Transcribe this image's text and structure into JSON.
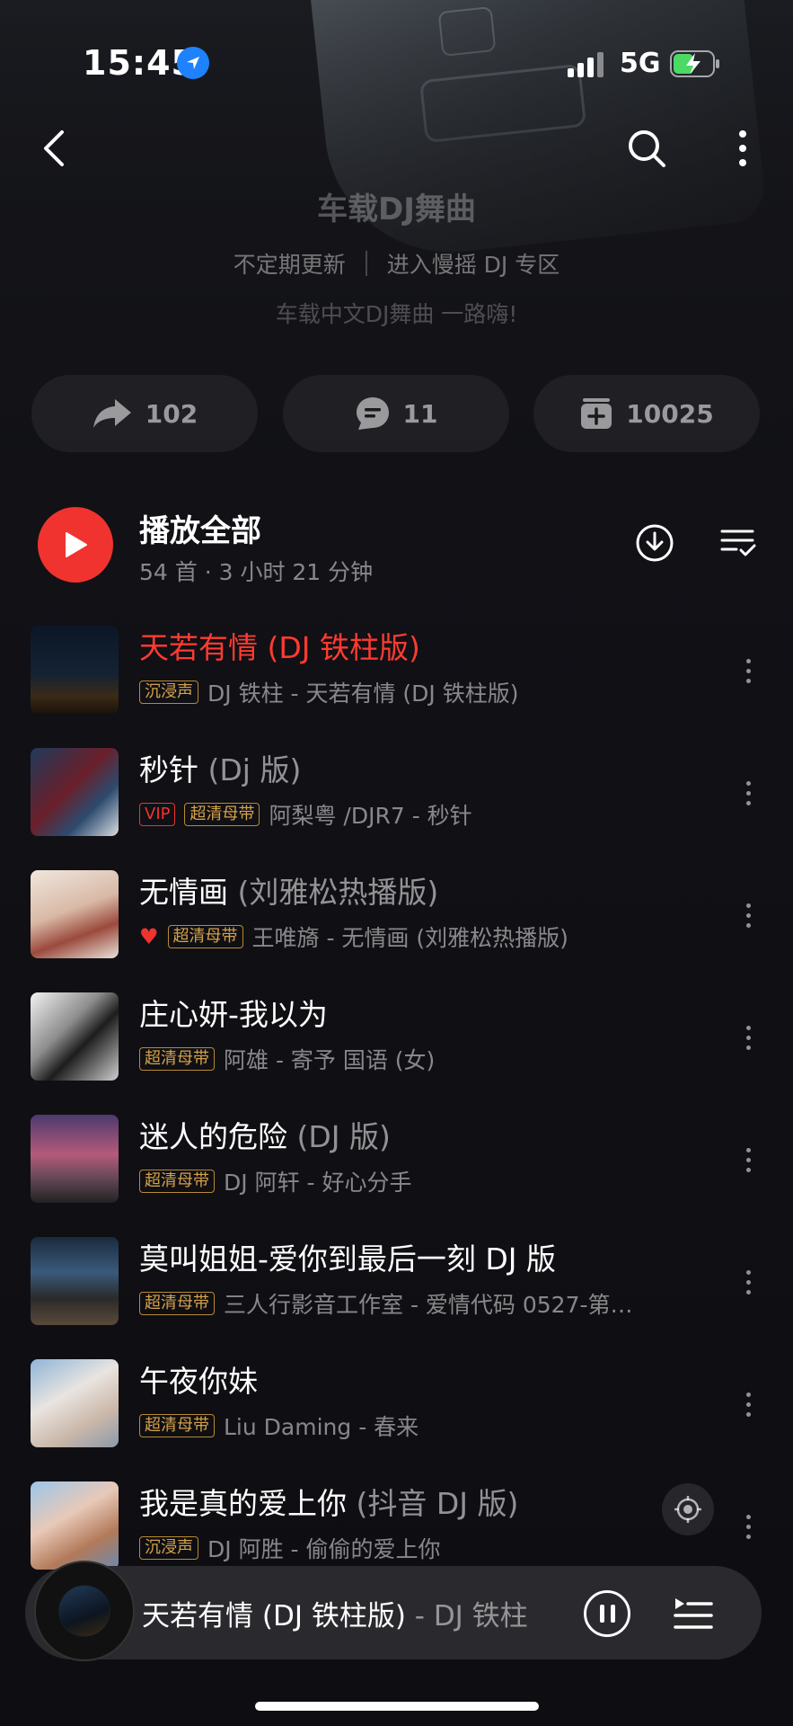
{
  "status": {
    "time": "15:45",
    "network": "5G"
  },
  "header": {
    "title": "车载DJ舞曲",
    "update_label": "不定期更新",
    "zone_link": "进入慢摇 DJ 专区",
    "description": "车载中文DJ舞曲 一路嗨!"
  },
  "actions": {
    "share_count": "102",
    "comment_count": "11",
    "collect_count": "10025"
  },
  "play_all": {
    "label": "播放全部",
    "meta": "54 首 · 3 小时 21 分钟"
  },
  "songs": [
    {
      "title": "天若有情 ",
      "version": "(DJ 铁柱版)",
      "tags": [
        "沉浸声"
      ],
      "subtitle": "DJ 铁柱 - 天若有情 (DJ 铁柱版)"
    },
    {
      "title": "秒针 ",
      "version": "(Dj 版)",
      "tags": [
        "VIP",
        "超清母带"
      ],
      "subtitle": "阿梨粤 /DJR7 - 秒针"
    },
    {
      "title": "无情画 ",
      "version": "(刘雅松热播版)",
      "tags": [
        "超清母带"
      ],
      "subtitle": "王唯旖 - 无情画 (刘雅松热播版)"
    },
    {
      "title": "庄心妍-我以为",
      "version": "",
      "tags": [
        "超清母带"
      ],
      "subtitle": "阿雄 - 寄予 国语 (女)"
    },
    {
      "title": "迷人的危险 ",
      "version": "(DJ 版)",
      "tags": [
        "超清母带"
      ],
      "subtitle": "DJ 阿轩 - 好心分手"
    },
    {
      "title": "莫叫姐姐-爱你到最后一刻 DJ 版",
      "version": "",
      "tags": [
        "超清母带"
      ],
      "subtitle": "三人行影音工作室 - 爱情代码 0527-第…"
    },
    {
      "title": "午夜你妹",
      "version": "",
      "tags": [
        "超清母带"
      ],
      "subtitle": "Liu Daming - 春来"
    },
    {
      "title": "我是真的爱上你 ",
      "version": "(抖音 DJ 版)",
      "tags": [
        "沉浸声"
      ],
      "subtitle": "DJ 阿胜 - 偷偷的爱上你"
    }
  ],
  "mini_player": {
    "title": "天若有情 (DJ 铁柱版)",
    "artist": " - DJ 铁柱"
  },
  "colors": {
    "accent": "#f0332f",
    "gold_tag": "#d4a24a",
    "background": "#0f0f13"
  }
}
